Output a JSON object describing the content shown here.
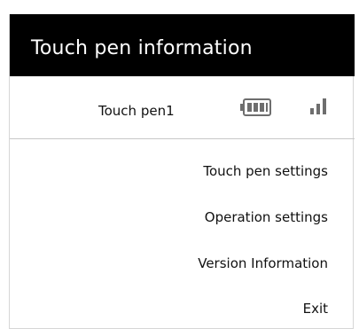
{
  "window": {
    "title": "Touch pen information"
  },
  "pen": {
    "name": "Touch pen1",
    "battery_icon": "battery-full-icon",
    "signal_icon": "signal-strength-icon"
  },
  "menu": {
    "items": [
      "Touch pen settings",
      "Operation settings",
      "Version Information",
      "Exit"
    ]
  },
  "colors": {
    "titlebar_bg": "#000000",
    "title_text": "#ffffff",
    "icon": "#6e6e6e"
  }
}
